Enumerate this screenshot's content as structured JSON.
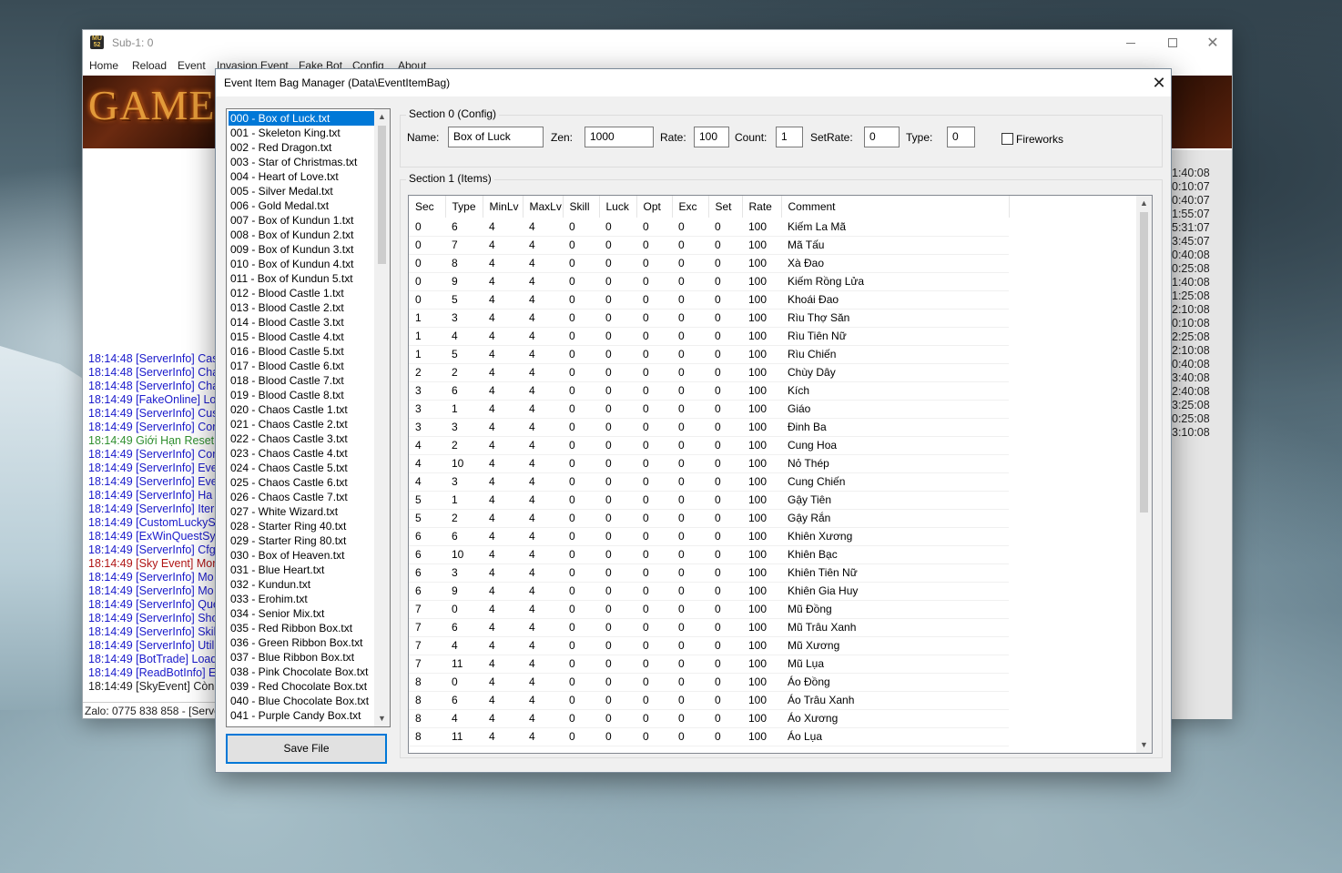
{
  "main_window": {
    "title": "Sub-1: 0",
    "menu": [
      "Home",
      "Reload",
      "Event",
      "Invasion Event",
      "Fake Bot",
      "Config",
      "About"
    ],
    "banner_text": "GAME-",
    "log_lines": [
      {
        "text": "18:14:48 [ServerInfo] Cas",
        "color": "blue"
      },
      {
        "text": "18:14:48 [ServerInfo] Cha",
        "color": "blue"
      },
      {
        "text": "18:14:48 [ServerInfo] Cha",
        "color": "blue"
      },
      {
        "text": "18:14:49 [FakeOnline] Lo",
        "color": "blue"
      },
      {
        "text": "18:14:49 [ServerInfo] Cus",
        "color": "blue"
      },
      {
        "text": "18:14:49 [ServerInfo] Cor",
        "color": "blue"
      },
      {
        "text": "18:14:49 Giới Hạn Reset:",
        "color": "green"
      },
      {
        "text": "18:14:49 [ServerInfo] Cor",
        "color": "blue"
      },
      {
        "text": "18:14:49 [ServerInfo] Eve",
        "color": "blue"
      },
      {
        "text": "18:14:49 [ServerInfo] Eve",
        "color": "blue"
      },
      {
        "text": "18:14:49 [ServerInfo] Ha",
        "color": "blue"
      },
      {
        "text": "18:14:49 [ServerInfo] Iter",
        "color": "blue"
      },
      {
        "text": "18:14:49 [CustomLuckyS",
        "color": "blue"
      },
      {
        "text": "18:14:49 [ExWinQuestSys",
        "color": "blue"
      },
      {
        "text": "18:14:49 [ServerInfo] Cfg",
        "color": "blue"
      },
      {
        "text": "18:14:49 [Sky Event] Mor",
        "color": "red"
      },
      {
        "text": "18:14:49 [ServerInfo] Mo",
        "color": "blue"
      },
      {
        "text": "18:14:49 [ServerInfo] Mo",
        "color": "blue"
      },
      {
        "text": "18:14:49 [ServerInfo] Que",
        "color": "blue"
      },
      {
        "text": "18:14:49 [ServerInfo] Sho",
        "color": "blue"
      },
      {
        "text": "18:14:49 [ServerInfo] Skil",
        "color": "blue"
      },
      {
        "text": "18:14:49 [ServerInfo] Util",
        "color": "blue"
      },
      {
        "text": "18:14:49 [BotTrade] Load",
        "color": "blue"
      },
      {
        "text": "18:14:49 [ReadBotInfo] E",
        "color": "blue"
      },
      {
        "text": "18:14:49 [SkyEvent] Còn",
        "color": "black"
      }
    ],
    "times": [
      "1:40:08",
      "0:10:07",
      "0:40:07",
      "1:55:07",
      "5:31:07",
      "3:45:07",
      "0:40:08",
      "0:25:08",
      "1:40:08",
      "1:25:08",
      "2:10:08",
      "0:10:08",
      "2:25:08",
      "2:10:08",
      "0:40:08",
      "3:40:08",
      "2:40:08",
      "3:25:08",
      "0:25:08",
      "3:10:08"
    ],
    "status_text": "Zalo: 0775 838 858 - [Server"
  },
  "dialog": {
    "title": "Event Item Bag Manager (Data\\EventItemBag)",
    "files": [
      "000 - Box of Luck.txt",
      "001 - Skeleton King.txt",
      "002 - Red Dragon.txt",
      "003 - Star of Christmas.txt",
      "004 - Heart of Love.txt",
      "005 - Silver Medal.txt",
      "006 - Gold Medal.txt",
      "007 - Box of Kundun 1.txt",
      "008 - Box of Kundun 2.txt",
      "009 - Box of Kundun 3.txt",
      "010 - Box of Kundun 4.txt",
      "011 - Box of Kundun 5.txt",
      "012 - Blood Castle 1.txt",
      "013 - Blood Castle 2.txt",
      "014 - Blood Castle 3.txt",
      "015 - Blood Castle 4.txt",
      "016 - Blood Castle 5.txt",
      "017 - Blood Castle 6.txt",
      "018 - Blood Castle 7.txt",
      "019 - Blood Castle 8.txt",
      "020 - Chaos Castle 1.txt",
      "021 - Chaos Castle 2.txt",
      "022 - Chaos Castle 3.txt",
      "023 - Chaos Castle 4.txt",
      "024 - Chaos Castle 5.txt",
      "025 - Chaos Castle 6.txt",
      "026 - Chaos Castle 7.txt",
      "027 - White Wizard.txt",
      "028 - Starter Ring 40.txt",
      "029 - Starter Ring 80.txt",
      "030 - Box of Heaven.txt",
      "031 - Blue Heart.txt",
      "032 - Kundun.txt",
      "033 - Erohim.txt",
      "034 - Senior Mix.txt",
      "035 - Red Ribbon Box.txt",
      "036 - Green Ribbon Box.txt",
      "037 - Blue Ribbon Box.txt",
      "038 - Pink Chocolate Box.txt",
      "039 - Red Chocolate Box.txt",
      "040 - Blue Chocolate Box.txt",
      "041 - Purple Candy Box.txt"
    ],
    "selected_index": 0,
    "save_button": "Save File",
    "section0": {
      "legend": "Section 0 (Config)",
      "name_label": "Name:",
      "name_value": "Box of Luck",
      "zen_label": "Zen:",
      "zen_value": "1000",
      "rate_label": "Rate:",
      "rate_value": "100",
      "count_label": "Count:",
      "count_value": "1",
      "setrate_label": "SetRate:",
      "setrate_value": "0",
      "type_label": "Type:",
      "type_value": "0",
      "fireworks_label": "Fireworks",
      "fireworks_checked": false
    },
    "section1": {
      "legend": "Section 1 (Items)",
      "columns": [
        "Sec",
        "Type",
        "MinLv",
        "MaxLv",
        "Skill",
        "Luck",
        "Opt",
        "Exc",
        "Set",
        "Rate",
        "Comment"
      ],
      "rows": [
        [
          "0",
          "6",
          "4",
          "4",
          "0",
          "0",
          "0",
          "0",
          "0",
          "100",
          "Kiếm La Mã"
        ],
        [
          "0",
          "7",
          "4",
          "4",
          "0",
          "0",
          "0",
          "0",
          "0",
          "100",
          "Mã Tấu"
        ],
        [
          "0",
          "8",
          "4",
          "4",
          "0",
          "0",
          "0",
          "0",
          "0",
          "100",
          "Xà Đao"
        ],
        [
          "0",
          "9",
          "4",
          "4",
          "0",
          "0",
          "0",
          "0",
          "0",
          "100",
          "Kiếm Rồng Lửa"
        ],
        [
          "0",
          "5",
          "4",
          "4",
          "0",
          "0",
          "0",
          "0",
          "0",
          "100",
          "Khoái Đao"
        ],
        [
          "1",
          "3",
          "4",
          "4",
          "0",
          "0",
          "0",
          "0",
          "0",
          "100",
          "Rìu Thợ Săn"
        ],
        [
          "1",
          "4",
          "4",
          "4",
          "0",
          "0",
          "0",
          "0",
          "0",
          "100",
          "Rìu Tiên Nữ"
        ],
        [
          "1",
          "5",
          "4",
          "4",
          "0",
          "0",
          "0",
          "0",
          "0",
          "100",
          "Rìu Chiến"
        ],
        [
          "2",
          "2",
          "4",
          "4",
          "0",
          "0",
          "0",
          "0",
          "0",
          "100",
          "Chùy Dây"
        ],
        [
          "3",
          "6",
          "4",
          "4",
          "0",
          "0",
          "0",
          "0",
          "0",
          "100",
          "Kích"
        ],
        [
          "3",
          "1",
          "4",
          "4",
          "0",
          "0",
          "0",
          "0",
          "0",
          "100",
          "Giáo"
        ],
        [
          "3",
          "3",
          "4",
          "4",
          "0",
          "0",
          "0",
          "0",
          "0",
          "100",
          "Đinh Ba"
        ],
        [
          "4",
          "2",
          "4",
          "4",
          "0",
          "0",
          "0",
          "0",
          "0",
          "100",
          "Cung Hoa"
        ],
        [
          "4",
          "10",
          "4",
          "4",
          "0",
          "0",
          "0",
          "0",
          "0",
          "100",
          "Nỏ Thép"
        ],
        [
          "4",
          "3",
          "4",
          "4",
          "0",
          "0",
          "0",
          "0",
          "0",
          "100",
          "Cung Chiến"
        ],
        [
          "5",
          "1",
          "4",
          "4",
          "0",
          "0",
          "0",
          "0",
          "0",
          "100",
          "Gậy Tiên"
        ],
        [
          "5",
          "2",
          "4",
          "4",
          "0",
          "0",
          "0",
          "0",
          "0",
          "100",
          "Gậy Rắn"
        ],
        [
          "6",
          "6",
          "4",
          "4",
          "0",
          "0",
          "0",
          "0",
          "0",
          "100",
          "Khiên Xương"
        ],
        [
          "6",
          "10",
          "4",
          "4",
          "0",
          "0",
          "0",
          "0",
          "0",
          "100",
          "Khiên Bạc"
        ],
        [
          "6",
          "3",
          "4",
          "4",
          "0",
          "0",
          "0",
          "0",
          "0",
          "100",
          "Khiên Tiên Nữ"
        ],
        [
          "6",
          "9",
          "4",
          "4",
          "0",
          "0",
          "0",
          "0",
          "0",
          "100",
          "Khiên Gia Huy"
        ],
        [
          "7",
          "0",
          "4",
          "4",
          "0",
          "0",
          "0",
          "0",
          "0",
          "100",
          "Mũ Đồng"
        ],
        [
          "7",
          "6",
          "4",
          "4",
          "0",
          "0",
          "0",
          "0",
          "0",
          "100",
          "Mũ Trâu Xanh"
        ],
        [
          "7",
          "4",
          "4",
          "4",
          "0",
          "0",
          "0",
          "0",
          "0",
          "100",
          "Mũ Xương"
        ],
        [
          "7",
          "11",
          "4",
          "4",
          "0",
          "0",
          "0",
          "0",
          "0",
          "100",
          "Mũ Lụa"
        ],
        [
          "8",
          "0",
          "4",
          "4",
          "0",
          "0",
          "0",
          "0",
          "0",
          "100",
          "Áo Đồng"
        ],
        [
          "8",
          "6",
          "4",
          "4",
          "0",
          "0",
          "0",
          "0",
          "0",
          "100",
          "Áo Trâu Xanh"
        ],
        [
          "8",
          "4",
          "4",
          "4",
          "0",
          "0",
          "0",
          "0",
          "0",
          "100",
          "Áo Xương"
        ],
        [
          "8",
          "11",
          "4",
          "4",
          "0",
          "0",
          "0",
          "0",
          "0",
          "100",
          "Áo Lụa"
        ]
      ]
    }
  }
}
